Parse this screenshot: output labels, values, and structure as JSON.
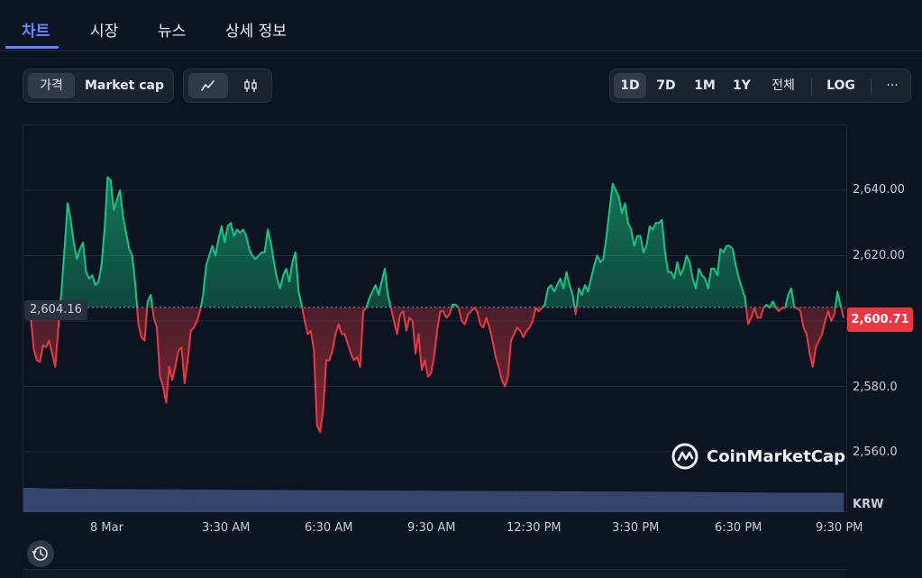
{
  "tabs": [
    {
      "label": "차트",
      "active": true
    },
    {
      "label": "시장",
      "active": false
    },
    {
      "label": "뉴스",
      "active": false
    },
    {
      "label": "상세 정보",
      "active": false
    }
  ],
  "metric_toggle": {
    "price": "가격",
    "market_cap": "Market cap",
    "selected": "price"
  },
  "chart_type_toggle": {
    "line_icon": "line-chart-icon",
    "candle_icon": "candlestick-icon",
    "selected": "line"
  },
  "range_buttons": {
    "d1": "1D",
    "d7": "7D",
    "m1": "1M",
    "y1": "1Y",
    "all": "전체",
    "log": "LOG",
    "more": "···",
    "selected": "1D"
  },
  "colors": {
    "up": "#16c784",
    "down": "#ea3943",
    "accent": "#6188ff",
    "volume": "#3d4d78"
  },
  "chart_data": {
    "type": "line",
    "currency": "KRW",
    "reference_value": 2604.16,
    "reference_label": "2,604.16",
    "current_value": 2600.71,
    "current_label": "2,600.71",
    "ylim": [
      2548,
      2658
    ],
    "y_ticks": [
      2560,
      2580,
      2600,
      2620,
      2640
    ],
    "y_tick_labels": [
      "2,560.0",
      "2,580.0",
      "2,600.0",
      "2,620.00",
      "2,640.00"
    ],
    "y_unit_label": "KRW",
    "x_tick_labels": [
      "8 Mar",
      "3:30 AM",
      "6:30 AM",
      "9:30 AM",
      "12:30 PM",
      "3:30 PM",
      "6:30 PM",
      "9:30 PM"
    ],
    "series": [
      {
        "values": [
          2601.5,
          2591.5,
          2588,
          2587.5,
          2592.5,
          2592,
          2594,
          2590,
          2586,
          2598,
          2609,
          2622,
          2636,
          2631,
          2624,
          2619,
          2622,
          2624,
          2615,
          2613,
          2614,
          2611,
          2612,
          2617,
          2628,
          2644,
          2643,
          2634,
          2637,
          2640,
          2632,
          2627,
          2622,
          2620,
          2611,
          2599,
          2595,
          2594,
          2606,
          2608,
          2601,
          2598,
          2583,
          2580,
          2575,
          2586,
          2582,
          2586,
          2591,
          2592,
          2581,
          2588,
          2597,
          2598,
          2600,
          2603,
          2608,
          2617,
          2620,
          2623,
          2620,
          2625,
          2629,
          2624,
          2629,
          2630,
          2626,
          2628,
          2627,
          2628,
          2626,
          2622,
          2620,
          2619,
          2620,
          2621,
          2621,
          2628,
          2624,
          2618,
          2613,
          2610,
          2614,
          2616,
          2612,
          2618,
          2621,
          2609,
          2605,
          2600,
          2596,
          2597,
          2591,
          2568,
          2566,
          2573,
          2588,
          2588,
          2591,
          2596,
          2599,
          2596,
          2596,
          2593,
          2590,
          2588,
          2589,
          2586,
          2603,
          2604,
          2607,
          2609,
          2611,
          2608,
          2612,
          2616,
          2608,
          2604,
          2600,
          2596,
          2602,
          2603,
          2597,
          2601,
          2600,
          2590,
          2596,
          2585,
          2588,
          2583,
          2584,
          2589,
          2597,
          2603,
          2603,
          2601,
          2602,
          2605,
          2605,
          2604,
          2600,
          2599,
          2602,
          2603,
          2604,
          2603,
          2599,
          2598,
          2601,
          2598,
          2594,
          2589,
          2586,
          2582,
          2580,
          2583,
          2594,
          2596,
          2598,
          2597,
          2595,
          2597,
          2598,
          2600,
          2604,
          2603,
          2604,
          2605,
          2610,
          2611,
          2609,
          2611,
          2613,
          2610,
          2615,
          2611,
          2608,
          2602,
          2610,
          2608,
          2611,
          2609,
          2613,
          2617,
          2620,
          2618,
          2619,
          2626,
          2634,
          2642,
          2640,
          2638,
          2633,
          2636,
          2630,
          2628,
          2623,
          2626,
          2626,
          2621,
          2623,
          2629,
          2628,
          2630,
          2630,
          2631,
          2621,
          2615,
          2615,
          2613,
          2618,
          2614,
          2616,
          2620,
          2618,
          2613,
          2610,
          2616,
          2614,
          2613,
          2610,
          2616,
          2616,
          2614,
          2622,
          2621,
          2623,
          2623,
          2622,
          2617,
          2613,
          2610,
          2607,
          2599,
          2601,
          2604,
          2601,
          2601,
          2604,
          2605,
          2604,
          2606,
          2604,
          2603,
          2604,
          2604,
          2608,
          2610,
          2604,
          2604,
          2603,
          2598,
          2596,
          2590,
          2586,
          2592,
          2594,
          2596,
          2600,
          2603,
          2600,
          2602,
          2609,
          2605,
          2601
        ]
      }
    ],
    "volume_relative": [
      1.0,
      0.99,
      0.98,
      0.97,
      0.97,
      0.96,
      0.96,
      0.955,
      0.95,
      0.95,
      0.948,
      0.945,
      0.94,
      0.94,
      0.938,
      0.935,
      0.935,
      0.93,
      0.93,
      0.928,
      0.925,
      0.925,
      0.922,
      0.92,
      0.92,
      0.918,
      0.915,
      0.915,
      0.912,
      0.91,
      0.91,
      0.905,
      0.9,
      0.9,
      0.9,
      0.898,
      0.895,
      0.895,
      0.892,
      0.89,
      0.89,
      0.888,
      0.885,
      0.885,
      0.882,
      0.88,
      0.88,
      0.88,
      0.878,
      0.875,
      0.875,
      0.872,
      0.87,
      0.87,
      0.868,
      0.865,
      0.865,
      0.862,
      0.86,
      0.86,
      0.858,
      0.855,
      0.855,
      0.852,
      0.85,
      0.85,
      0.848,
      0.845,
      0.845,
      0.842,
      0.84,
      0.84,
      0.835,
      0.83,
      0.83,
      0.825,
      0.82,
      0.82,
      0.815,
      0.81,
      0.81,
      0.805,
      0.8,
      0.8,
      0.8,
      0.8,
      0.8,
      0.8,
      0.8,
      0.8
    ]
  }
}
